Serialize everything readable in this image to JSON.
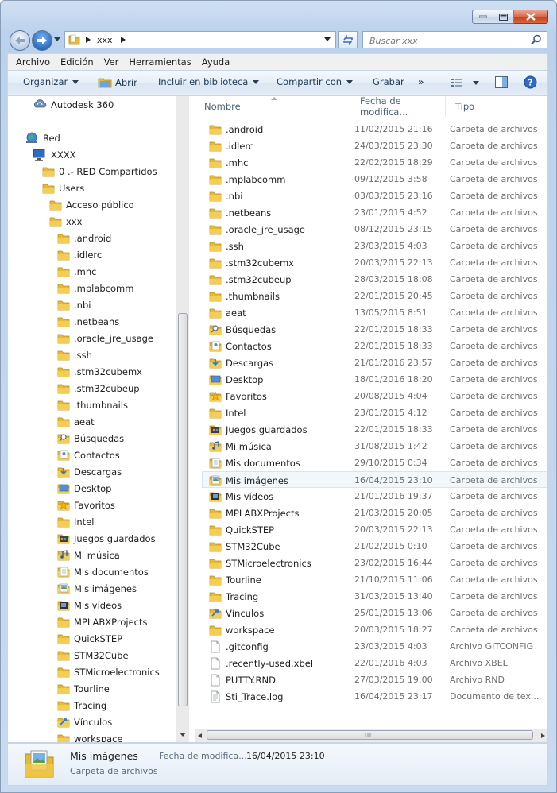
{
  "address": {
    "crumb": "xxx"
  },
  "search": {
    "placeholder": "Buscar xxx"
  },
  "menu": [
    "Archivo",
    "Edición",
    "Ver",
    "Herramientas",
    "Ayuda"
  ],
  "toolbar": {
    "organize": "Organizar",
    "open": "Abrir",
    "include": "Incluir en biblioteca",
    "share": "Compartir con",
    "burn": "Grabar",
    "more": "»"
  },
  "columns": {
    "name": "Nombre",
    "date": "Fecha de modifica...",
    "type": "Tipo"
  },
  "nav": {
    "items": [
      {
        "label": "Autodesk 360",
        "icon": "cloud-sync-icon"
      },
      {
        "label": "Red",
        "icon": "network-icon"
      },
      {
        "label": "XXXX",
        "icon": "computer-icon"
      },
      {
        "label": "0 .- RED Compartidos",
        "icon": "folder-icon"
      },
      {
        "label": "Users",
        "icon": "folder-icon"
      },
      {
        "label": "Acceso público",
        "icon": "folder-icon"
      },
      {
        "label": "xxx",
        "icon": "folder-icon"
      },
      {
        "label": ".android",
        "icon": "folder-icon"
      },
      {
        "label": ".idlerc",
        "icon": "folder-icon"
      },
      {
        "label": ".mhc",
        "icon": "folder-icon"
      },
      {
        "label": ".mplabcomm",
        "icon": "folder-icon"
      },
      {
        "label": ".nbi",
        "icon": "folder-icon"
      },
      {
        "label": ".netbeans",
        "icon": "folder-icon"
      },
      {
        "label": ".oracle_jre_usage",
        "icon": "folder-icon"
      },
      {
        "label": ".ssh",
        "icon": "folder-icon"
      },
      {
        "label": ".stm32cubemx",
        "icon": "folder-icon"
      },
      {
        "label": ".stm32cubeup",
        "icon": "folder-icon"
      },
      {
        "label": ".thumbnails",
        "icon": "folder-icon"
      },
      {
        "label": "aeat",
        "icon": "folder-icon"
      },
      {
        "label": "Búsquedas",
        "icon": "searches-folder-icon"
      },
      {
        "label": "Contactos",
        "icon": "contacts-folder-icon"
      },
      {
        "label": "Descargas",
        "icon": "downloads-folder-icon"
      },
      {
        "label": "Desktop",
        "icon": "desktop-folder-icon"
      },
      {
        "label": "Favoritos",
        "icon": "favorites-folder-icon"
      },
      {
        "label": "Intel",
        "icon": "folder-icon"
      },
      {
        "label": "Juegos guardados",
        "icon": "saved-games-folder-icon"
      },
      {
        "label": "Mi música",
        "icon": "music-folder-icon"
      },
      {
        "label": "Mis documentos",
        "icon": "documents-folder-icon"
      },
      {
        "label": "Mis imágenes",
        "icon": "pictures-folder-icon"
      },
      {
        "label": "Mis vídeos",
        "icon": "videos-folder-icon"
      },
      {
        "label": "MPLABXProjects",
        "icon": "folder-icon"
      },
      {
        "label": "QuickSTEP",
        "icon": "folder-icon"
      },
      {
        "label": "STM32Cube",
        "icon": "folder-icon"
      },
      {
        "label": "STMicroelectronics",
        "icon": "folder-icon"
      },
      {
        "label": "Tourline",
        "icon": "folder-icon"
      },
      {
        "label": "Tracing",
        "icon": "folder-icon"
      },
      {
        "label": "Vínculos",
        "icon": "links-folder-icon"
      },
      {
        "label": "workspace",
        "icon": "folder-icon"
      }
    ]
  },
  "files": [
    {
      "name": ".android",
      "date": "11/02/2015 21:16",
      "type": "Carpeta de archivos",
      "icon": "folder-icon"
    },
    {
      "name": ".idlerc",
      "date": "24/03/2015 23:30",
      "type": "Carpeta de archivos",
      "icon": "folder-icon"
    },
    {
      "name": ".mhc",
      "date": "22/02/2015 18:29",
      "type": "Carpeta de archivos",
      "icon": "folder-icon"
    },
    {
      "name": ".mplabcomm",
      "date": "09/12/2015 3:58",
      "type": "Carpeta de archivos",
      "icon": "folder-icon"
    },
    {
      "name": ".nbi",
      "date": "03/03/2015 23:16",
      "type": "Carpeta de archivos",
      "icon": "folder-icon"
    },
    {
      "name": ".netbeans",
      "date": "23/01/2015 4:52",
      "type": "Carpeta de archivos",
      "icon": "folder-icon"
    },
    {
      "name": ".oracle_jre_usage",
      "date": "08/12/2015 23:15",
      "type": "Carpeta de archivos",
      "icon": "folder-icon"
    },
    {
      "name": ".ssh",
      "date": "23/03/2015 4:03",
      "type": "Carpeta de archivos",
      "icon": "folder-icon"
    },
    {
      "name": ".stm32cubemx",
      "date": "20/03/2015 22:13",
      "type": "Carpeta de archivos",
      "icon": "folder-icon"
    },
    {
      "name": ".stm32cubeup",
      "date": "28/03/2015 18:08",
      "type": "Carpeta de archivos",
      "icon": "folder-icon"
    },
    {
      "name": ".thumbnails",
      "date": "22/01/2015 20:45",
      "type": "Carpeta de archivos",
      "icon": "folder-icon"
    },
    {
      "name": "aeat",
      "date": "13/05/2015 8:51",
      "type": "Carpeta de archivos",
      "icon": "folder-icon"
    },
    {
      "name": "Búsquedas",
      "date": "22/01/2015 18:33",
      "type": "Carpeta de archivos",
      "icon": "searches-folder-icon"
    },
    {
      "name": "Contactos",
      "date": "22/01/2015 18:33",
      "type": "Carpeta de archivos",
      "icon": "contacts-folder-icon"
    },
    {
      "name": "Descargas",
      "date": "21/01/2016 23:57",
      "type": "Carpeta de archivos",
      "icon": "downloads-folder-icon"
    },
    {
      "name": "Desktop",
      "date": "18/01/2016 18:20",
      "type": "Carpeta de archivos",
      "icon": "desktop-folder-icon"
    },
    {
      "name": "Favoritos",
      "date": "20/08/2015 4:04",
      "type": "Carpeta de archivos",
      "icon": "favorites-folder-icon"
    },
    {
      "name": "Intel",
      "date": "23/01/2015 4:12",
      "type": "Carpeta de archivos",
      "icon": "folder-icon"
    },
    {
      "name": "Juegos guardados",
      "date": "22/01/2015 18:33",
      "type": "Carpeta de archivos",
      "icon": "saved-games-folder-icon"
    },
    {
      "name": "Mi música",
      "date": "31/08/2015 1:42",
      "type": "Carpeta de archivos",
      "icon": "music-folder-icon"
    },
    {
      "name": "Mis documentos",
      "date": "29/10/2015 0:34",
      "type": "Carpeta de archivos",
      "icon": "documents-folder-icon"
    },
    {
      "name": "Mis imágenes",
      "date": "16/04/2015 23:10",
      "type": "Carpeta de archivos",
      "icon": "pictures-folder-icon",
      "selected": true
    },
    {
      "name": "Mis vídeos",
      "date": "21/01/2016 19:37",
      "type": "Carpeta de archivos",
      "icon": "videos-folder-icon"
    },
    {
      "name": "MPLABXProjects",
      "date": "21/03/2015 20:05",
      "type": "Carpeta de archivos",
      "icon": "folder-icon"
    },
    {
      "name": "QuickSTEP",
      "date": "20/03/2015 22:13",
      "type": "Carpeta de archivos",
      "icon": "folder-icon"
    },
    {
      "name": "STM32Cube",
      "date": "21/02/2015 0:10",
      "type": "Carpeta de archivos",
      "icon": "folder-icon"
    },
    {
      "name": "STMicroelectronics",
      "date": "23/02/2015 16:44",
      "type": "Carpeta de archivos",
      "icon": "folder-icon"
    },
    {
      "name": "Tourline",
      "date": "21/10/2015 11:06",
      "type": "Carpeta de archivos",
      "icon": "folder-icon"
    },
    {
      "name": "Tracing",
      "date": "31/03/2015 13:40",
      "type": "Carpeta de archivos",
      "icon": "folder-icon"
    },
    {
      "name": "Vínculos",
      "date": "25/01/2015 13:06",
      "type": "Carpeta de archivos",
      "icon": "links-folder-icon"
    },
    {
      "name": "workspace",
      "date": "20/03/2015 18:27",
      "type": "Carpeta de archivos",
      "icon": "folder-icon"
    },
    {
      "name": ".gitconfig",
      "date": "23/03/2015 4:03",
      "type": "Archivo GITCONFIG",
      "icon": "file-icon"
    },
    {
      "name": ".recently-used.xbel",
      "date": "22/01/2016 4:03",
      "type": "Archivo XBEL",
      "icon": "file-icon"
    },
    {
      "name": "PUTTY.RND",
      "date": "27/03/2015 19:00",
      "type": "Archivo RND",
      "icon": "file-icon"
    },
    {
      "name": "Sti_Trace.log",
      "date": "16/04/2015 23:17",
      "type": "Documento de tex...",
      "icon": "text-file-icon"
    }
  ],
  "details": {
    "name": "Mis imágenes",
    "date_label": "Fecha de modifica...",
    "date_value": "16/04/2015 23:10",
    "type": "Carpeta de archivos",
    "icon": "pictures-folder-icon"
  },
  "colors": {
    "folder": "#e8b932",
    "selection": "#f2f7fc",
    "frame": "#c4d8ef"
  }
}
